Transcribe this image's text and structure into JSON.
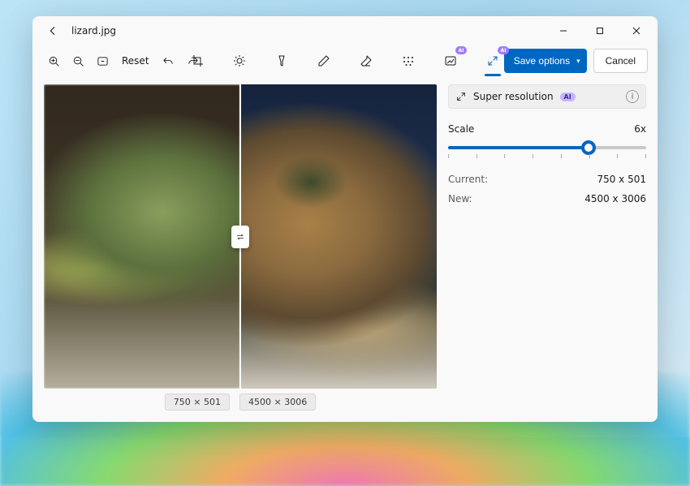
{
  "window": {
    "title": "lizard.jpg"
  },
  "toolbar": {
    "reset_label": "Reset",
    "ai_badge": "AI",
    "save_label": "Save options",
    "cancel_label": "Cancel"
  },
  "panel": {
    "title": "Super resolution",
    "ai_pill": "AI",
    "scale_label": "Scale",
    "scale_value": "6x",
    "slider": {
      "min": 1,
      "max": 8,
      "value": 6,
      "ticks": 8,
      "fill_pct": 71
    },
    "current_label": "Current:",
    "current_value": "750 x 501",
    "new_label": "New:",
    "new_value": "4500 x 3006"
  },
  "canvas": {
    "left_dim": "750 × 501",
    "right_dim": "4500 × 3006",
    "split_pct": 50
  }
}
